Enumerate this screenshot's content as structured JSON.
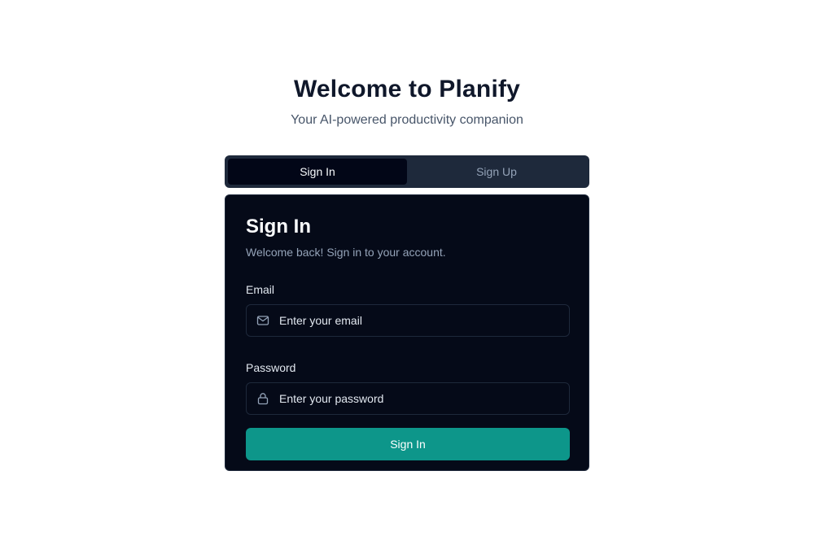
{
  "header": {
    "title": "Welcome to Planify",
    "subtitle": "Your AI-powered productivity companion"
  },
  "tabs": [
    {
      "label": "Sign In",
      "active": true
    },
    {
      "label": "Sign Up",
      "active": false
    }
  ],
  "card": {
    "title": "Sign In",
    "description": "Welcome back! Sign in to your account.",
    "email": {
      "label": "Email",
      "placeholder": "Enter your email",
      "value": "",
      "icon": "mail-icon"
    },
    "password": {
      "label": "Password",
      "placeholder": "Enter your password",
      "value": "",
      "icon": "lock-icon"
    },
    "submit_label": "Sign In"
  },
  "colors": {
    "accent": "#0d968a",
    "card_bg": "#050a18",
    "tabs_bg": "#1e293b",
    "title_text": "#0f172a"
  }
}
